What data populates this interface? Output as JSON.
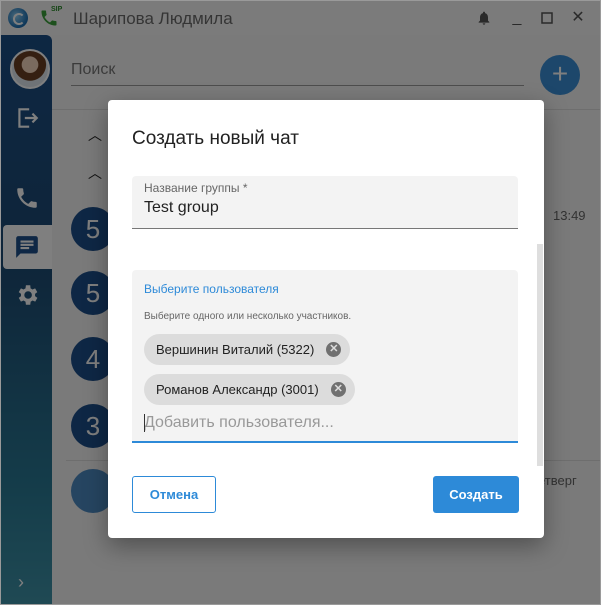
{
  "window": {
    "title": "Шарипова Людмила",
    "sip_badge": "SIP"
  },
  "titlebar_controls": [
    "bell-icon",
    "minimize-icon",
    "maximize-icon",
    "close-icon"
  ],
  "sidebar": {
    "items": [
      "logout-icon",
      "phone-icon",
      "chat-icon",
      "settings-icon"
    ],
    "active": "chat-icon",
    "expand": "›"
  },
  "main": {
    "search_placeholder": "Поиск",
    "fab": "+",
    "chat_circles": [
      "5",
      "5",
      "4",
      "3"
    ],
    "time": "13:49",
    "day_partial": "етверг"
  },
  "dialog": {
    "title": "Создать новый чат",
    "group_field": {
      "label": "Название группы *",
      "value": "Test group"
    },
    "users": {
      "label": "Выберите пользователя",
      "hint": "Выберите одного или несколько участников.",
      "chips": [
        "Вершинин Виталий (5322)",
        "Романов Александр (3001)"
      ],
      "add_placeholder": "Добавить пользователя..."
    },
    "cancel_label": "Отмена",
    "create_label": "Создать"
  },
  "colors": {
    "accent": "#2d8ad8",
    "sidebar": "#1d4a73",
    "fab": "#3a8fd6"
  }
}
